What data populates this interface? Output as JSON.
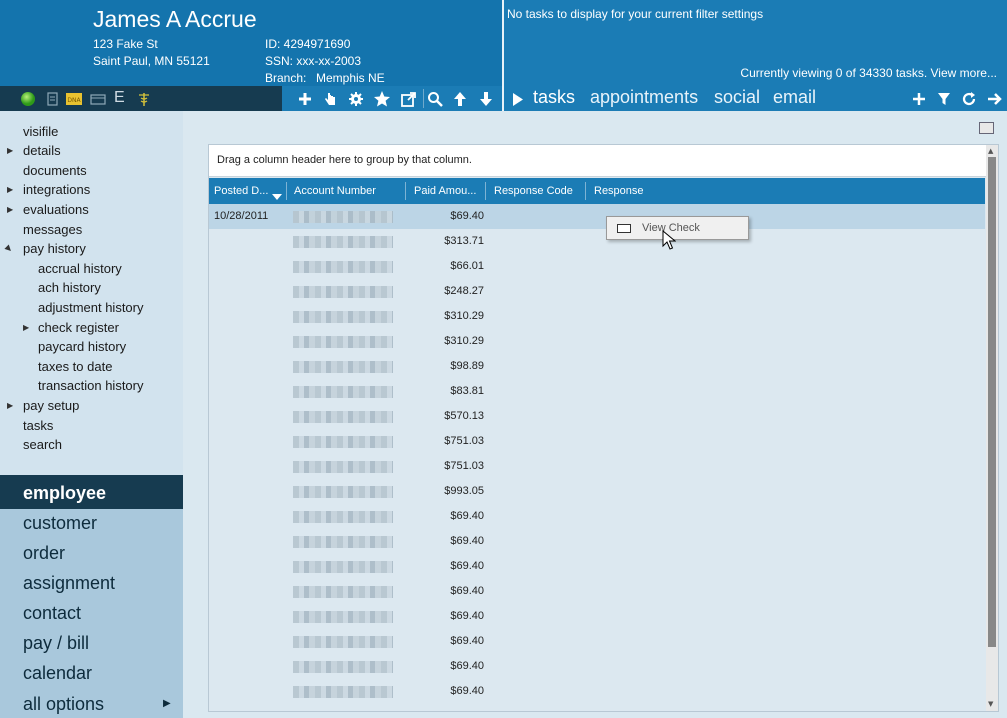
{
  "employee": {
    "name": "James A Accrue",
    "address1": "123 Fake St",
    "address2": "Saint Paul, MN 55121",
    "id": "ID: 4294971690",
    "ssn": "SSN: xxx-xx-2003",
    "branch_label": "Branch:",
    "branch": "Memphis NE"
  },
  "tasks_panel": {
    "message": "No tasks to display for your current filter settings",
    "viewing": "Currently viewing 0 of 34330 tasks. View more..."
  },
  "tabs": [
    {
      "label": "tasks"
    },
    {
      "label": "appointments"
    },
    {
      "label": "social"
    },
    {
      "label": "email"
    }
  ],
  "status_icons": [
    "green-status-icon",
    "document-icon",
    "dna-icon",
    "card-icon",
    "e-verify-icon",
    "medical-icon"
  ],
  "status_text": {
    "dna": "DNA",
    "e": "E"
  },
  "toolbar_icons": [
    "add-icon",
    "hand-icon",
    "gear-icon",
    "star-icon",
    "export-icon",
    "search-icon",
    "arrow-up-icon",
    "arrow-down-icon"
  ],
  "tab_actions": [
    "add-icon",
    "filter-icon",
    "refresh-icon",
    "forward-icon"
  ],
  "sidebar": {
    "items": [
      {
        "label": "visifile"
      },
      {
        "label": "details"
      },
      {
        "label": "documents"
      },
      {
        "label": "integrations"
      },
      {
        "label": "evaluations"
      },
      {
        "label": "messages"
      },
      {
        "label": "pay history"
      },
      {
        "label": "accrual history"
      },
      {
        "label": "ach history"
      },
      {
        "label": "adjustment history"
      },
      {
        "label": "check register"
      },
      {
        "label": "paycard history"
      },
      {
        "label": "taxes to date"
      },
      {
        "label": "transaction history"
      },
      {
        "label": "pay setup"
      },
      {
        "label": "tasks"
      },
      {
        "label": "search"
      }
    ],
    "main_nav": [
      {
        "label": "employee"
      },
      {
        "label": "customer"
      },
      {
        "label": "order"
      },
      {
        "label": "assignment"
      },
      {
        "label": "contact"
      },
      {
        "label": "pay / bill"
      },
      {
        "label": "calendar"
      },
      {
        "label": "all options"
      }
    ]
  },
  "grid": {
    "group_hint": "Drag a column header here to group by that column.",
    "columns": [
      "Posted D...",
      "Account Number",
      "Paid Amou...",
      "Response Code",
      "Response"
    ],
    "rows": [
      {
        "date": "10/28/2011",
        "amount": "$69.40"
      },
      {
        "date": "",
        "amount": "$313.71"
      },
      {
        "date": "",
        "amount": "$66.01"
      },
      {
        "date": "",
        "amount": "$248.27"
      },
      {
        "date": "",
        "amount": "$310.29"
      },
      {
        "date": "",
        "amount": "$310.29"
      },
      {
        "date": "",
        "amount": "$98.89"
      },
      {
        "date": "",
        "amount": "$83.81"
      },
      {
        "date": "",
        "amount": "$570.13"
      },
      {
        "date": "",
        "amount": "$751.03"
      },
      {
        "date": "",
        "amount": "$751.03"
      },
      {
        "date": "",
        "amount": "$993.05"
      },
      {
        "date": "",
        "amount": "$69.40"
      },
      {
        "date": "",
        "amount": "$69.40"
      },
      {
        "date": "",
        "amount": "$69.40"
      },
      {
        "date": "",
        "amount": "$69.40"
      },
      {
        "date": "",
        "amount": "$69.40"
      },
      {
        "date": "",
        "amount": "$69.40"
      },
      {
        "date": "",
        "amount": "$69.40"
      },
      {
        "date": "",
        "amount": "$69.40"
      }
    ]
  },
  "context_menu": {
    "item": "View Check"
  }
}
